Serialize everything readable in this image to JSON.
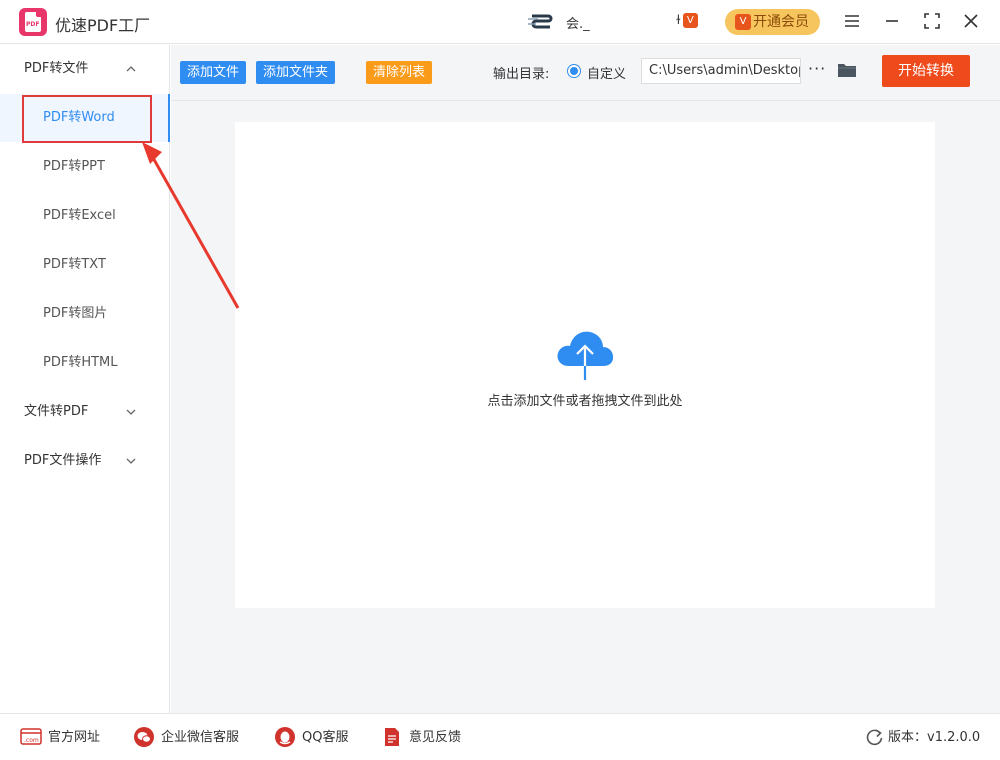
{
  "app": {
    "title": "优速PDF工厂",
    "logo_text": "PDF",
    "user_name": "会._",
    "vip_small_label": "VIP",
    "vip_button_label": "开通会员",
    "brand_color": "#e8366a",
    "accent_color": "#2f8cf0"
  },
  "window_controls": {
    "menu_icon": "hamburger-icon",
    "minimize_icon": "minimize-icon",
    "maximize_icon": "maximize-icon",
    "close_icon": "close-icon"
  },
  "sidebar": {
    "groups": [
      {
        "label": "PDF转文件",
        "expanded": true,
        "items": [
          {
            "label": "PDF转Word",
            "active": true
          },
          {
            "label": "PDF转PPT",
            "active": false
          },
          {
            "label": "PDF转Excel",
            "active": false
          },
          {
            "label": "PDF转TXT",
            "active": false
          },
          {
            "label": "PDF转图片",
            "active": false
          },
          {
            "label": "PDF转HTML",
            "active": false
          }
        ]
      },
      {
        "label": "文件转PDF",
        "expanded": false
      },
      {
        "label": "PDF文件操作",
        "expanded": false
      }
    ]
  },
  "toolbar": {
    "add_file": "添加文件",
    "add_folder": "添加文件夹",
    "clear_list": "清除列表",
    "output_dir_label": "输出目录:",
    "custom_option": "自定义",
    "output_path": "C:\\Users\\admin\\Desktop",
    "more": "···",
    "start": "开始转换"
  },
  "dropzone": {
    "hint": "点击添加文件或者拖拽文件到此处"
  },
  "statusbar": {
    "website": "官方网址",
    "wechat_support": "企业微信客服",
    "qq_support": "QQ客服",
    "feedback": "意见反馈",
    "version": "版本：v1.2.0.0"
  }
}
